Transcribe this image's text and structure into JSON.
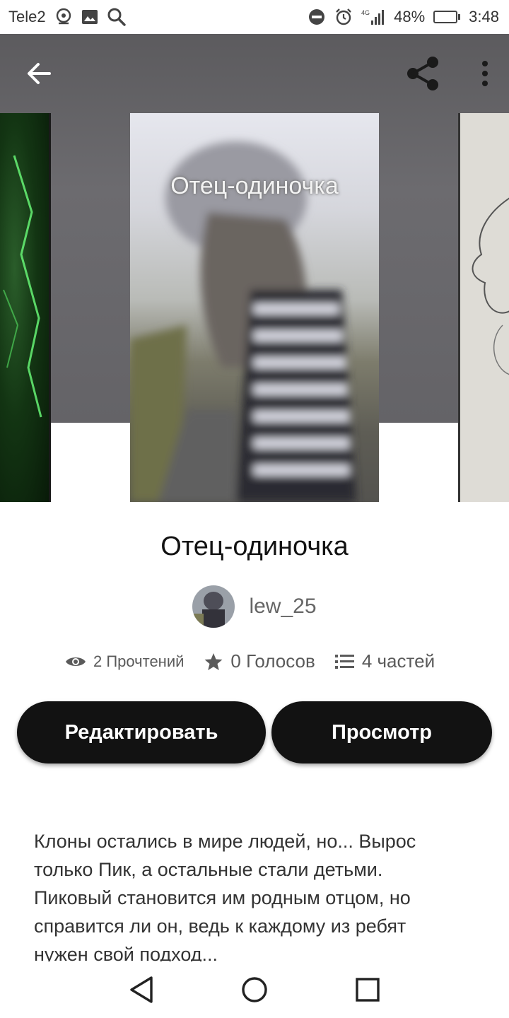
{
  "status_bar": {
    "carrier": "Tele2",
    "network": "4G",
    "battery": "48%",
    "battery_level": 0.48,
    "time": "3:48"
  },
  "toolbar": {
    "back_icon": "arrow-left-icon",
    "share_icon": "share-icon",
    "more_icon": "more-vertical-icon"
  },
  "cover": {
    "overlay_title": "Отец-одиночка"
  },
  "story": {
    "title": "Отец-одиночка",
    "author": "lew_25",
    "reads": "2 Прочтений",
    "votes": "0 Голосов",
    "parts": "4 частей",
    "description": "Клоны остались в мире людей, но... Вырос только Пик, а остальные стали детьми. Пиковый становится им родным отцом, но справится ли он, ведь к каждому из ребят нужен свой подход..."
  },
  "actions": {
    "edit_label": "Редактировать",
    "preview_label": "Просмотр"
  },
  "colors": {
    "button_bg": "#121212",
    "button_text": "#ffffff",
    "hero_bg": "#646367",
    "meta_text": "#5a5a5a"
  }
}
